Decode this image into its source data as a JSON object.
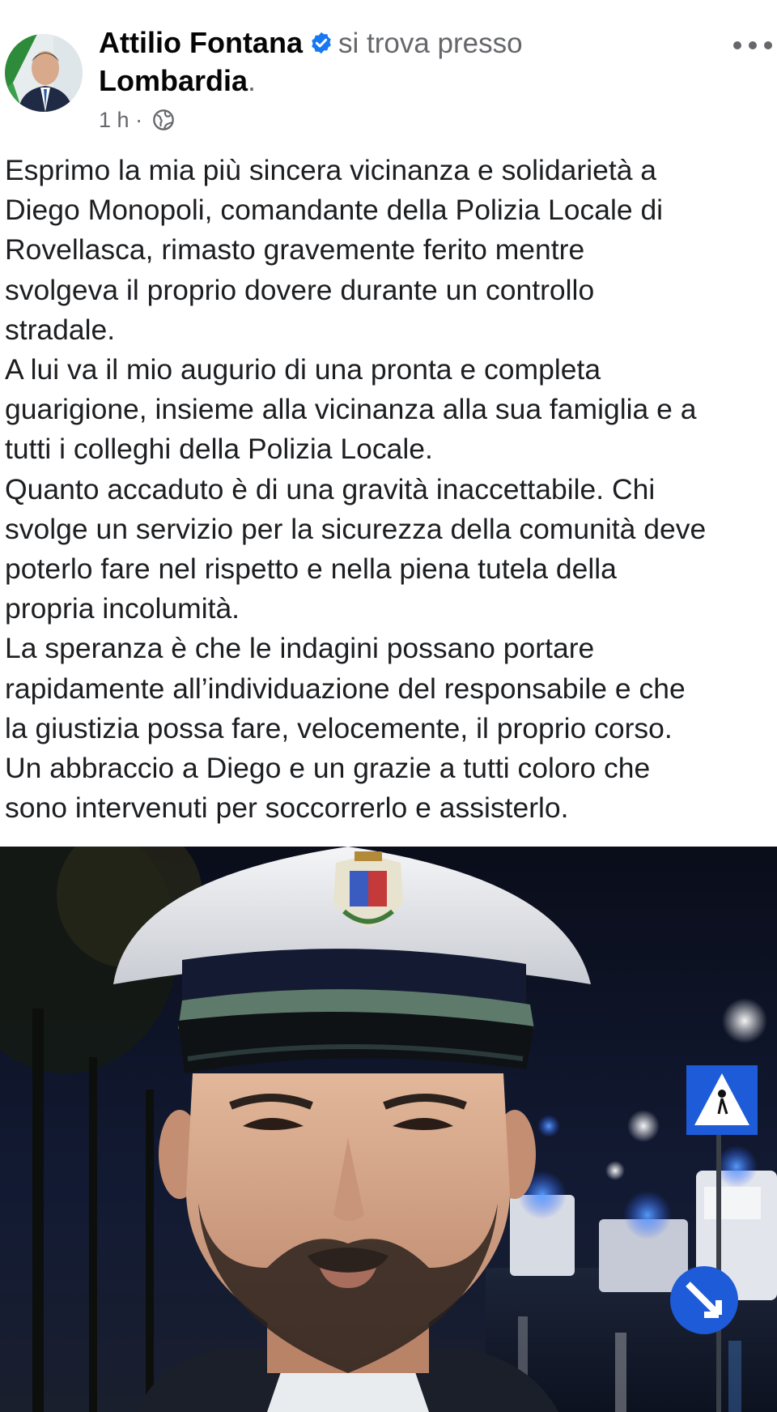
{
  "post": {
    "author": "Attilio Fontana",
    "location_prefix": "si trova presso",
    "location": "Lombardia",
    "location_suffix": ".",
    "time": "1 h",
    "separator": "·",
    "privacy_icon": "globe-icon",
    "verified_icon": "verified-badge-icon",
    "more_icon": "more-options-icon",
    "text_lines": [
      "Esprimo la mia più sincera vicinanza e solidarietà a",
      "Diego Monopoli, comandante della Polizia Locale di",
      "Rovellasca, rimasto gravemente ferito mentre",
      "svolgeva il proprio dovere durante un controllo",
      "stradale.",
      "A lui va il mio augurio di una pronta e completa",
      "guarigione, insieme alla vicinanza alla sua famiglia e a",
      "tutti i colleghi della Polizia Locale.",
      "Quanto accaduto è di una gravità inaccettabile. Chi",
      "svolge un servizio per la sicurezza della comunità deve",
      "poterlo fare nel rispetto e nella piena tutela della",
      "propria incolumità.",
      "La speranza è che le indagini possano portare",
      "rapidamente all’individuazione del responsabile e che",
      "la giustizia possa fare, velocemente, il proprio corso.",
      "Un abbraccio a Diego e un grazie a tutti coloro che",
      "sono intervenuti per soccorrerlo e assisterlo."
    ]
  },
  "colors": {
    "text": "#1c1e21",
    "secondary": "#65676b",
    "verified": "#1877f2",
    "photo_background": "#0b0f1e"
  }
}
